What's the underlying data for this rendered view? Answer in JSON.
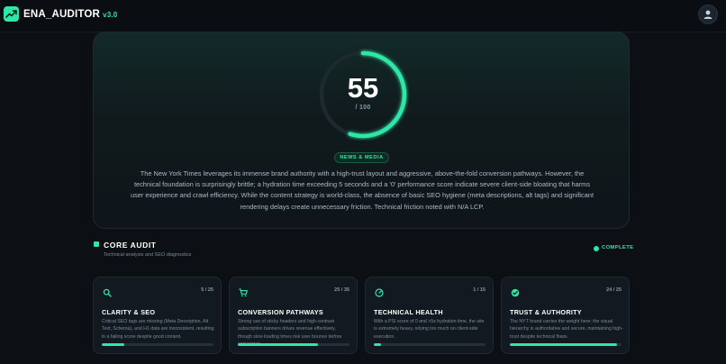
{
  "app": {
    "name": "ENA_AUDITOR",
    "version": "v3.0"
  },
  "colors": {
    "accent": "#2ee6a6",
    "background": "#0c1015",
    "card": "#121920"
  },
  "hero": {
    "score": "55",
    "score_max": "/ 100",
    "score_fraction": 0.55,
    "category_tag": "NEWS & MEDIA",
    "summary": "The New York Times leverages its immense brand authority with a high-trust layout and aggressive, above-the-fold conversion pathways. However, the technical foundation is surprisingly brittle; a hydration time exceeding 5 seconds and a '0' performance score indicate severe client-side bloating that harms user experience and crawl efficiency. While the content strategy is world-class, the absence of basic SEO hygiene (meta descriptions, alt tags) and significant rendering delays create unnecessary friction. Technical friction noted with N/A LCP."
  },
  "section": {
    "title": "CORE AUDIT",
    "subtitle": "Technical analysis and SEO diagnostics",
    "status": "COMPLETE"
  },
  "cards": [
    {
      "icon": "search-icon",
      "score": "5 / 25",
      "fraction": 0.2,
      "title": "CLARITY & SEO",
      "description": "Critical SEO tags are missing (Meta Description, Alt Text, Schema), and H1 data are inconsistent, resulting in a failing score despite good content."
    },
    {
      "icon": "cart-icon",
      "score": "25 / 35",
      "fraction": 0.714,
      "title": "CONVERSION PATHWAYS",
      "description": "Strong use of sticky headers and high-contrast subscription banners drives revenue effectively, though slow loading times risk user bounce before conversion."
    },
    {
      "icon": "gauge-icon",
      "score": "1 / 15",
      "fraction": 0.067,
      "title": "TECHNICAL HEALTH",
      "description": "With a PSI score of 0 and >5s hydration time, the site is extremely heavy, relying too much on client-side execution."
    },
    {
      "icon": "shield-check-icon",
      "score": "24 / 25",
      "fraction": 0.96,
      "title": "TRUST & AUTHORITY",
      "description": "The NYT brand carries the weight here; the visual hierarchy is authoritative and secure, maintaining high-trust despite technical flaws."
    }
  ]
}
